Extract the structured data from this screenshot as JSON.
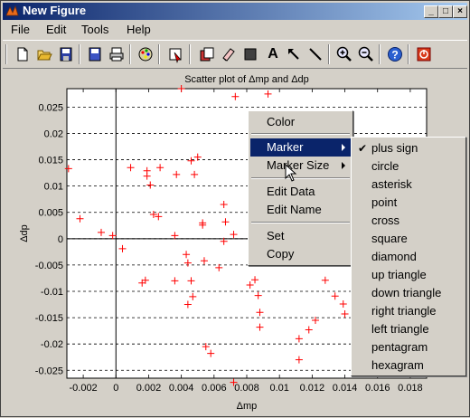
{
  "window": {
    "title": "New Figure",
    "min_glyph": "_",
    "max_glyph": "□",
    "close_glyph": "×"
  },
  "menubar": [
    "File",
    "Edit",
    "Tools",
    "Help"
  ],
  "toolbar": {
    "icons": [
      "new-document-icon",
      "open-folder-icon",
      "save-icon",
      "save-figure-icon",
      "print-icon",
      "color-palette-icon",
      "edit-plot-icon",
      "copy-figure-icon",
      "eraser-icon",
      "rectangle-icon",
      "text-a-icon",
      "arrow-icon",
      "line-icon",
      "zoom-in-icon",
      "zoom-out-icon",
      "help-icon",
      "stop-icon"
    ],
    "text_tool_glyph": "A"
  },
  "chart_data": {
    "type": "scatter",
    "title": "Scatter plot of Δmp and Δdp",
    "xlabel": "Δmp",
    "ylabel": "Δdp",
    "xlim": [
      -0.003,
      0.019
    ],
    "ylim": [
      -0.0265,
      0.0285
    ],
    "xticks": [
      "-0.002",
      "0",
      "0.002",
      "0.004",
      "0.006",
      "0.008",
      "0.01",
      "0.012",
      "0.014",
      "0.016",
      "0.018"
    ],
    "xtick_values": [
      -0.002,
      0,
      0.002,
      0.004,
      0.006,
      0.008,
      0.01,
      0.012,
      0.014,
      0.016,
      0.018
    ],
    "yticks": [
      "0.025",
      "0.02",
      "0.015",
      "0.01",
      "0.005",
      "0",
      "-0.005",
      "-0.01",
      "-0.015",
      "-0.02",
      "-0.025"
    ],
    "ytick_values": [
      0.025,
      0.02,
      0.015,
      0.01,
      0.005,
      0,
      -0.005,
      -0.01,
      -0.015,
      -0.02,
      -0.025
    ],
    "grid": "horizontal dashed",
    "marker": "plus sign",
    "color": "#ff0000",
    "points": [
      [
        -0.0029,
        0.0133
      ],
      [
        -0.0022,
        0.0038
      ],
      [
        -0.0009,
        0.0012
      ],
      [
        -0.0002,
        0.0006
      ],
      [
        0.0004,
        -0.0019
      ],
      [
        0.0009,
        0.0135
      ],
      [
        0.0016,
        -0.0084
      ],
      [
        0.0018,
        -0.0079
      ],
      [
        0.0019,
        0.0129
      ],
      [
        0.0019,
        0.0119
      ],
      [
        0.0021,
        0.0102
      ],
      [
        0.0023,
        0.0046
      ],
      [
        0.0026,
        0.0042
      ],
      [
        0.0027,
        0.0135
      ],
      [
        0.0037,
        0.0122
      ],
      [
        0.0036,
        0.0006
      ],
      [
        0.0036,
        -0.008
      ],
      [
        0.004,
        0.0285
      ],
      [
        0.0043,
        -0.003
      ],
      [
        0.0044,
        -0.0046
      ],
      [
        0.0044,
        -0.0125
      ],
      [
        0.0046,
        0.0148
      ],
      [
        0.0046,
        -0.008
      ],
      [
        0.0047,
        -0.011
      ],
      [
        0.0048,
        0.0122
      ],
      [
        0.005,
        0.0155
      ],
      [
        0.0053,
        0.003
      ],
      [
        0.0053,
        0.0026
      ],
      [
        0.0054,
        -0.0042
      ],
      [
        0.0055,
        -0.0205
      ],
      [
        0.0058,
        -0.0218
      ],
      [
        0.0063,
        -0.0055
      ],
      [
        0.0066,
        0.0065
      ],
      [
        0.0067,
        0.0032
      ],
      [
        0.0066,
        -0.0005
      ],
      [
        0.0072,
        -0.0273
      ],
      [
        0.0073,
        0.027
      ],
      [
        0.0072,
        0.0008
      ],
      [
        0.0082,
        -0.0088
      ],
      [
        0.0085,
        -0.0078
      ],
      [
        0.0087,
        -0.0108
      ],
      [
        0.0088,
        -0.014
      ],
      [
        0.0088,
        -0.0168
      ],
      [
        0.0093,
        0.0275
      ],
      [
        0.0112,
        -0.019
      ],
      [
        0.0112,
        -0.023
      ],
      [
        0.0118,
        -0.0173
      ],
      [
        0.0122,
        -0.0155
      ],
      [
        0.0128,
        -0.0079
      ],
      [
        0.0134,
        -0.0109
      ],
      [
        0.0139,
        -0.0124
      ],
      [
        0.014,
        -0.0143
      ]
    ]
  },
  "context_menu": {
    "items": [
      "Color",
      "Marker",
      "Marker Size",
      "Edit Data",
      "Edit Name",
      "Set",
      "Copy"
    ],
    "highlighted": "Marker"
  },
  "marker_submenu": {
    "items": [
      "plus sign",
      "circle",
      "asterisk",
      "point",
      "cross",
      "square",
      "diamond",
      "up triangle",
      "down triangle",
      "right triangle",
      "left triangle",
      "pentagram",
      "hexagram"
    ],
    "checked": "plus sign",
    "check_glyph": "✔"
  }
}
